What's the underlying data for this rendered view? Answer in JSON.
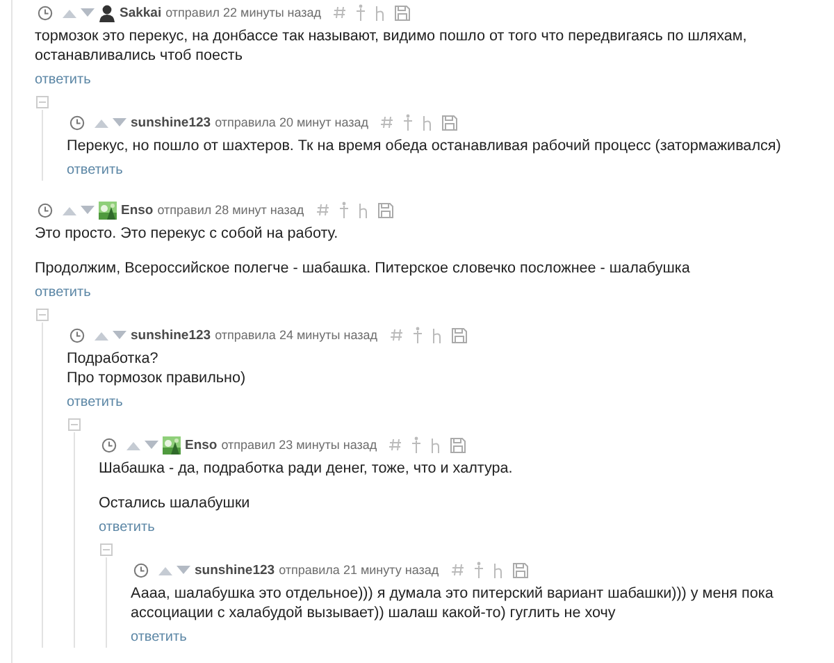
{
  "comments": [
    {
      "author": "Sakkai",
      "avatar": {
        "kind": "silhouette"
      },
      "verb": "отправил",
      "time": "22 минуты назад",
      "paragraphs": [
        "тормозок это перекус, на донбассе так называют, видимо пошло от того что передвигаясь по шляхам, останавливались чтоб поесть"
      ],
      "reply": "ответить",
      "children": [
        {
          "author": "sunshine123",
          "verb": "отправила",
          "time": "20 минут назад",
          "paragraphs": [
            "Перекус, но пошло от шахтеров. Тк на время обеда останавливая рабочий процесс (затормаживался)"
          ],
          "reply": "ответить"
        }
      ]
    },
    {
      "author": "Enso",
      "avatar": {
        "kind": "picture"
      },
      "verb": "отправил",
      "time": "28 минут назад",
      "paragraphs": [
        "Это просто. Это перекус с собой на работу.",
        "Продолжим, Всероссийское полегче - шабашка. Питерское словечко посложнее - шалабушка"
      ],
      "reply": "ответить",
      "children": [
        {
          "author": "sunshine123",
          "verb": "отправила",
          "time": "24 минуты назад",
          "paragraphs": [
            "Подработка?\nПро тормозок правильно)"
          ],
          "reply": "ответить",
          "children": [
            {
              "author": "Enso",
              "avatar": {
                "kind": "picture"
              },
              "verb": "отправил",
              "time": "23 минуты назад",
              "paragraphs": [
                "Шабашка - да, подработка ради денег, тоже, что и халтура.",
                "Остались шалабушки"
              ],
              "reply": "ответить",
              "children": [
                {
                  "author": "sunshine123",
                  "verb": "отправила",
                  "time": "21 минуту назад",
                  "paragraphs": [
                    "Аааа, шалабушка это отдельное))) я думала это питерский вариант шабашки))) у меня пока ассоциации с халабудой вызывает)) шалаш какой-то) гуглить не хочу"
                  ],
                  "reply": "ответить"
                }
              ]
            }
          ]
        }
      ]
    }
  ]
}
